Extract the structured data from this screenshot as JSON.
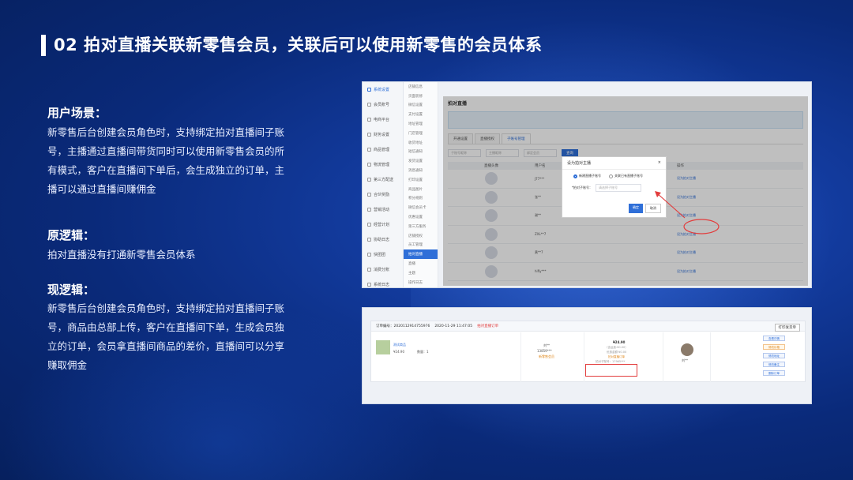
{
  "title": "02 拍对直播关联新零售会员，关联后可以使用新零售的会员体系",
  "sections": [
    {
      "heading": "用户场景：",
      "body": "新零售后台创建会员角色时，支持绑定拍对直播间子账号，主播通过直播间带货同时可以使用新零售会员的所有模式，客户在直播间下单后，会生成独立的订单，主播可以通过直播间赚佣金"
    },
    {
      "heading": "原逻辑：",
      "body": "拍对直播没有打通新零售会员体系"
    },
    {
      "heading": "现逻辑：",
      "body": "新零售后台创建会员角色时，支持绑定拍对直播间子账号，商品由总部上传，客户在直播间下单，生成会员独立的订单，会员拿直播间商品的差价，直播间可以分享赚取佣金"
    }
  ],
  "shot1": {
    "nav": [
      "系统设置",
      "会员账号",
      "电商平台",
      "财务设置",
      "商品管理",
      "物流管理",
      "第三方配送",
      "合伙奖励",
      "营销活动",
      "经营计划",
      "协助日志",
      "快团团",
      "消费分账",
      "系统日志"
    ],
    "sub": [
      "店铺信息",
      "页面装修",
      "微信设置",
      "支付设置",
      "地址管理",
      "门店管理",
      "收货地址",
      "短信通知",
      "发货设置",
      "消息通知",
      "打印设置",
      "商品图片",
      "积分规则",
      "微信会员卡",
      "优惠设置",
      "第三方服务",
      "店铺授权",
      "员工管理",
      "拍对直播",
      "直播",
      "主题",
      "操作日志"
    ],
    "page_title": "拍对直播",
    "tabs": [
      "开通设置",
      "直播授权",
      "子账号管理"
    ],
    "filter_placeholders": [
      "子账号昵称",
      "主播昵称",
      "绑定会员"
    ],
    "search_label": "查询",
    "table_headers": [
      "直播头像",
      "用户名",
      "操作"
    ],
    "rows": [
      {
        "name": "J77***",
        "action": "设为拍对主播"
      },
      {
        "name": "张**",
        "action": "设为拍对主播"
      },
      {
        "name": "谢**",
        "action": "设为拍对主播"
      },
      {
        "name": "ZXL**7",
        "action": "设为拍对主播"
      },
      {
        "name": "黄**7",
        "action": "设为拍对主播"
      },
      {
        "name": "hifly***",
        "action": "设为拍对主播"
      }
    ],
    "modal": {
      "title": "设为拍对主播",
      "close": "×",
      "radio_a": "新建直播子账号",
      "radio_b": "关联已有直播子账号",
      "field_label": "*拍对子账号：",
      "field_placeholder": "请选择子账号",
      "ok": "确定",
      "cancel": "取消"
    }
  },
  "shot2": {
    "order_no": "订单编号：2020112914755976",
    "time": "2020-11-29 11:47:05",
    "status": "拍对直播订单",
    "print": "打印发货单",
    "goods_name": "测试商品",
    "goods_price": "¥24.90",
    "goods_qty": "数量：1",
    "buyer_name": "刘**",
    "buyer_phone": "13859***",
    "buyer_tag": "新零售会员",
    "amount": "¥24.90",
    "amount_note1": "（含运费:¥0.00）",
    "amount_note2": "优惠金额:¥0.00",
    "live_tag": "拍对直播订单",
    "live_account": "拍对子账号：17965***",
    "anchor_name": "刘**",
    "buttons": [
      "查看详情",
      "修改价格",
      "修改地址",
      "修改备注",
      "删除订单"
    ]
  }
}
